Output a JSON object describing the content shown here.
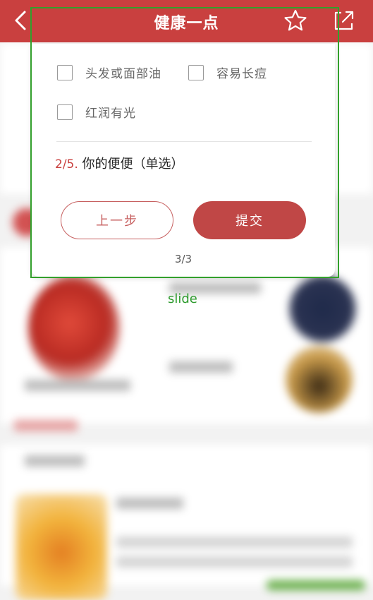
{
  "header": {
    "title": "健康一点",
    "background_color": "#c9403f"
  },
  "options": [
    {
      "label": "头发或面部油",
      "checked": false
    },
    {
      "label": "容易长痘",
      "checked": false
    },
    {
      "label": "红润有光",
      "checked": false
    }
  ],
  "question": {
    "number": "2/5.",
    "text": "你的便便（单选）"
  },
  "buttons": {
    "prev_label": "上一步",
    "submit_label": "提交"
  },
  "pagination": "3/3",
  "annotation": {
    "label": "slide",
    "color": "#33a02c"
  }
}
